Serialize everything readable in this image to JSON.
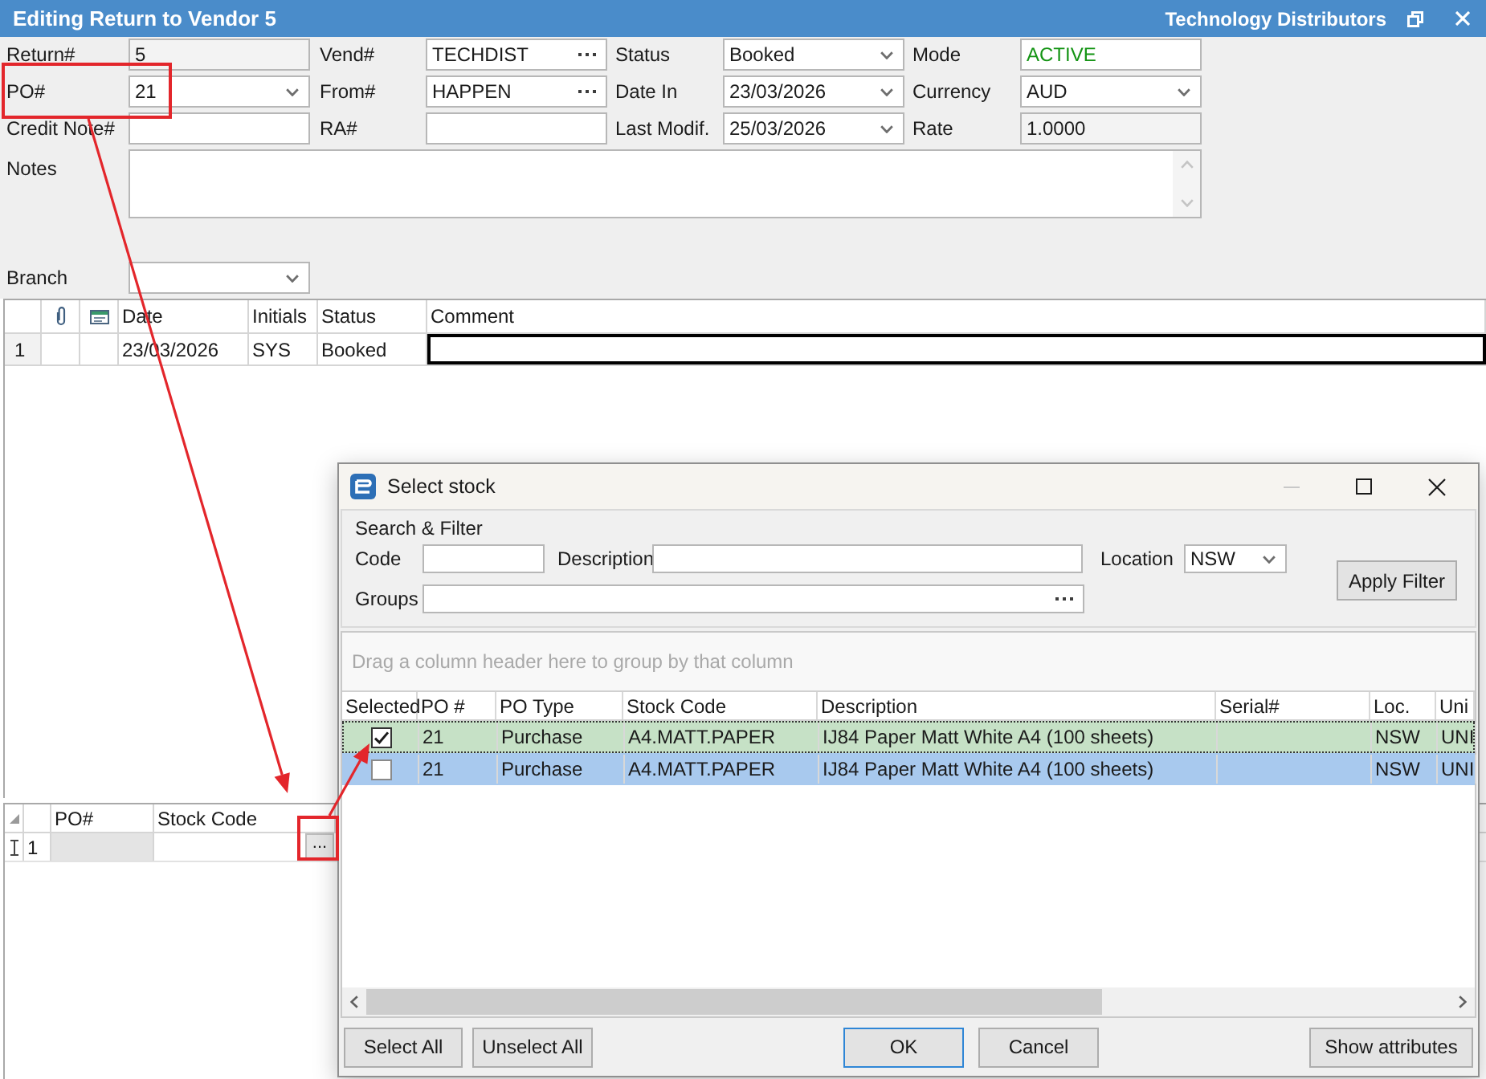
{
  "window": {
    "title": "Editing Return to Vendor 5",
    "company": "Technology Distributors"
  },
  "form": {
    "rows": [
      [
        {
          "label": "Return#",
          "value": "5",
          "kind": "readonly"
        },
        {
          "label": "Vend#",
          "value": "TECHDIST",
          "kind": "lookup"
        },
        {
          "label": "Status",
          "value": "Booked",
          "kind": "dropdown"
        },
        {
          "label": "Mode",
          "value": "ACTIVE",
          "kind": "text",
          "color": "#149414"
        }
      ],
      [
        {
          "label": "PO#",
          "value": "21",
          "kind": "dropdown"
        },
        {
          "label": "From#",
          "value": "HAPPEN",
          "kind": "lookup"
        },
        {
          "label": "Date In",
          "value": "23/03/2026",
          "kind": "dropdown"
        },
        {
          "label": "Currency",
          "value": "AUD",
          "kind": "dropdown"
        }
      ],
      [
        {
          "label": "Credit Note#",
          "kind": "text"
        },
        {
          "label": "RA#",
          "kind": "text"
        },
        {
          "label": "Last Modif.",
          "value": "25/03/2026",
          "kind": "dropdown"
        },
        {
          "label": "Rate",
          "value": "1.0000",
          "kind": "readonly"
        }
      ]
    ],
    "notes": {
      "label": "Notes"
    },
    "branch": {
      "label": "Branch"
    }
  },
  "history_grid": {
    "columns": [
      "Date",
      "Initials",
      "Status",
      "Comment"
    ],
    "rows": [
      {
        "number": "1",
        "date": "23/03/2026",
        "initials": "SYS",
        "status": "Booked",
        "comment_focused": true
      }
    ]
  },
  "lines_grid": {
    "columns": [
      "PO#",
      "Stock Code"
    ],
    "rows": [
      {
        "number": "1",
        "editing": true,
        "lookup_button": "..."
      }
    ]
  },
  "dialog": {
    "title": "Select stock",
    "filter": {
      "title": "Search & Filter",
      "code_label": "Code",
      "description_label": "Description",
      "location_label": "Location",
      "location_value": "NSW",
      "groups_label": "Groups",
      "apply_button": "Apply Filter"
    },
    "group_hint": "Drag a column header here to group by that column",
    "columns": [
      "Selected",
      "PO #",
      "PO Type",
      "Stock Code",
      "Description",
      "Serial#",
      "Loc.",
      "Uni"
    ],
    "rows": [
      {
        "checked": true,
        "selected": false,
        "focused": true,
        "po": "21",
        "po_type": "Purchase",
        "stock_code": "A4.MATT.PAPER",
        "description": "IJ84 Paper Matt White A4 (100 sheets)",
        "location": "NSW",
        "unit": "UNI"
      },
      {
        "checked": false,
        "selected": true,
        "focused": false,
        "po": "21",
        "po_type": "Purchase",
        "stock_code": "A4.MATT.PAPER",
        "description": "IJ84 Paper Matt White A4 (100 sheets)",
        "location": "NSW",
        "unit": "UNI"
      }
    ],
    "buttons": {
      "left": [
        "Select All",
        "Unselect All"
      ],
      "center": [
        {
          "label": "OK",
          "default": true
        },
        {
          "label": "Cancel",
          "default": false
        }
      ],
      "right": [
        "Show attributes"
      ]
    }
  }
}
